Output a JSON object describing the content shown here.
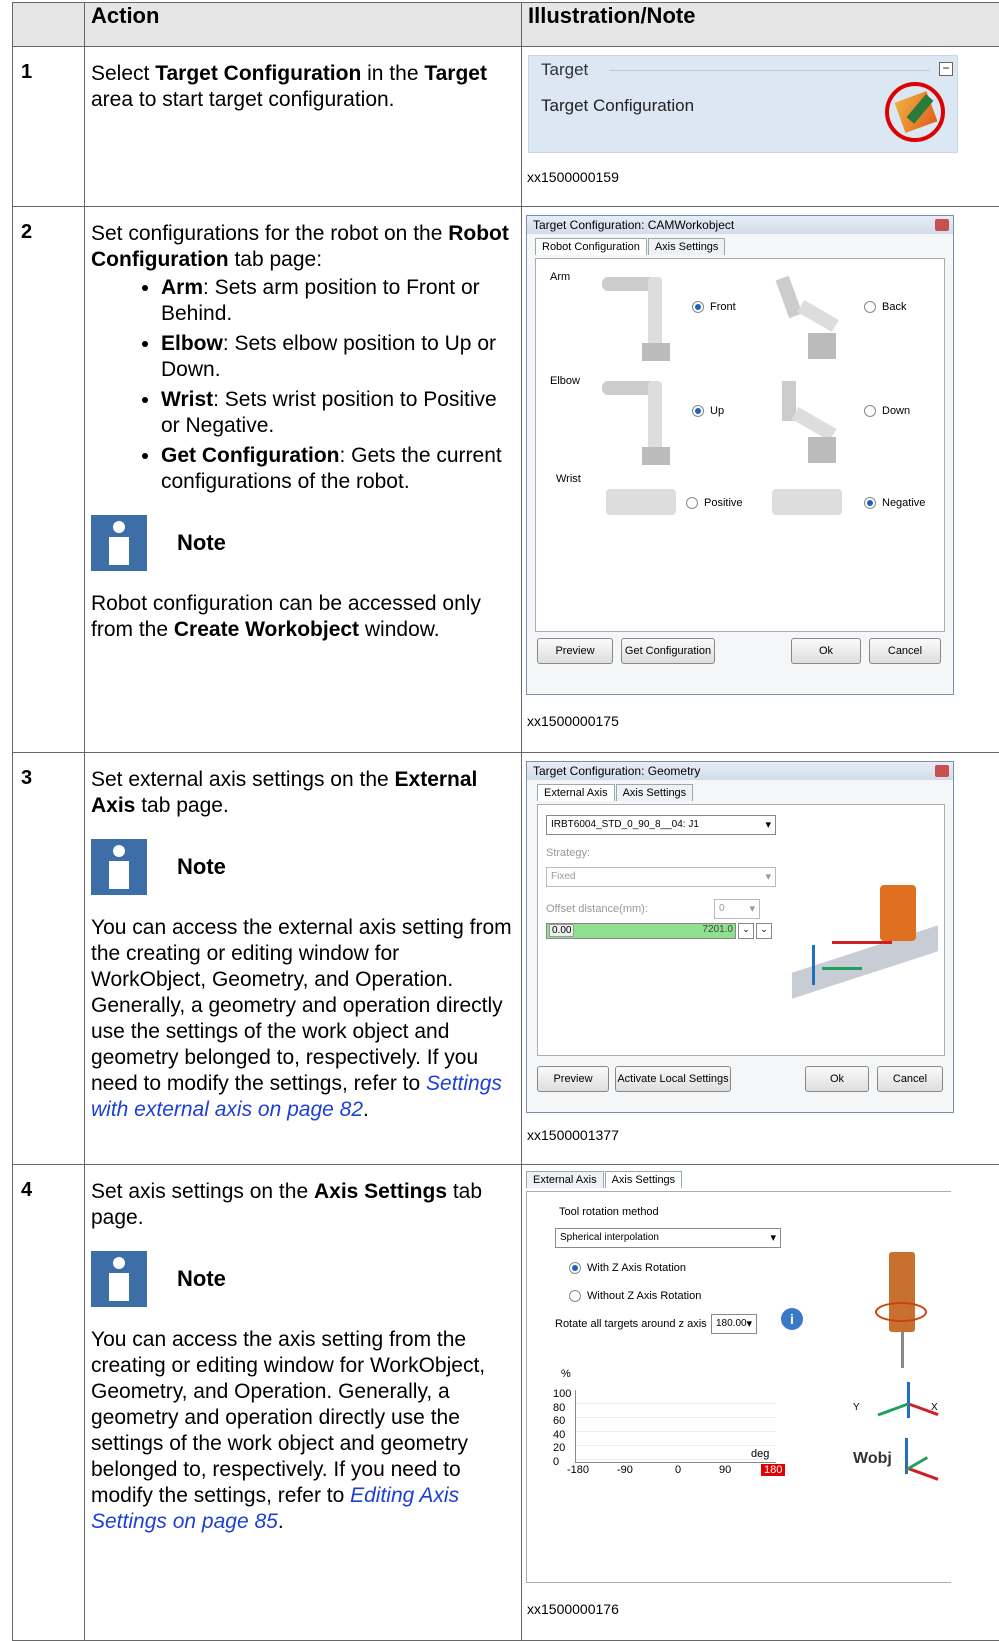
{
  "table": {
    "headers": [
      "",
      "Action",
      "Illustration/Note"
    ]
  },
  "rows": [
    {
      "num": "1",
      "action_parts": [
        "Select ",
        "Target Configuration",
        " in the ",
        "Target",
        " area to start target configuration."
      ],
      "figure": {
        "area_title": "Target",
        "item_label": "Target Configuration",
        "code": "xx1500000159"
      }
    },
    {
      "num": "2",
      "intro_parts": [
        "Set configurations for the robot on the ",
        "Robot Configuration",
        " tab page:"
      ],
      "bullets": [
        {
          "term": "Arm",
          "text": ": Sets arm position to Front or Behind."
        },
        {
          "term": "Elbow",
          "text": ": Sets elbow position to Up or Down."
        },
        {
          "term": "Wrist",
          "text": ": Sets wrist position to Positive or Negative."
        },
        {
          "term": "Get Configuration",
          "text": ": Gets the current configurations of the robot."
        }
      ],
      "note_label": "Note",
      "note_parts": [
        "Robot configuration can be accessed only from the ",
        "Create Workobject",
        " window."
      ],
      "figure": {
        "title": "Target Configuration: CAMWorkobject",
        "tabs": [
          "Robot Configuration",
          "Axis Settings"
        ],
        "groups": [
          {
            "label": "Arm",
            "opt1": "Front",
            "opt2": "Back"
          },
          {
            "label": "Elbow",
            "opt1": "Up",
            "opt2": "Down"
          },
          {
            "label": "Wrist",
            "opt1": "Positive",
            "opt2": "Negative"
          }
        ],
        "buttons": [
          "Preview",
          "Get Configuration",
          "Ok",
          "Cancel"
        ],
        "code": "xx1500000175"
      }
    },
    {
      "num": "3",
      "action_parts": [
        "Set external axis settings on the ",
        "External Axis",
        " tab page."
      ],
      "note_label": "Note",
      "note_text": "You can access the external axis setting from the creating or editing window for WorkObject, Geometry, and Operation. Generally, a geometry and operation directly use the settings of the work object and geometry belonged to, respectively. If you need to modify the settings, refer to ",
      "link": "Settings with external axis on page 82",
      "note_end": ".",
      "figure": {
        "title": "Target Configuration: Geometry",
        "tabs": [
          "External Axis",
          "Axis Settings"
        ],
        "axis_select": "IRBT6004_STD_0_90_8__04: J1",
        "strategy_label": "Strategy:",
        "strategy_value": "Fixed",
        "offset_label": "Offset distance(mm):",
        "offset_value": "0",
        "slider_min": "0.00",
        "slider_max": "7201.0",
        "buttons": [
          "Preview",
          "Activate Local Settings",
          "Ok",
          "Cancel"
        ],
        "code": "xx1500001377"
      }
    },
    {
      "num": "4",
      "action_parts": [
        "Set axis settings on the ",
        "Axis Settings",
        " tab page."
      ],
      "note_label": "Note",
      "note_text": "You can access the axis setting from the creating or editing window for WorkObject, Geometry, and Operation. Generally, a geometry and operation directly use the settings of the work object and geometry belonged to, respectively. If you need to modify the settings, refer to ",
      "link": "Editing Axis Settings on page 85",
      "note_end": ".",
      "figure": {
        "tabs": [
          "External Axis",
          "Axis Settings"
        ],
        "method_label": "Tool rotation method",
        "method_value": "Spherical interpolation",
        "radio1": "With Z Axis Rotation",
        "radio2": "Without Z Axis Rotation",
        "rotate_label": "Rotate all targets around z axis",
        "rotate_value": "180.00",
        "chart_unit": "%",
        "y_ticks": [
          "100",
          "80",
          "60",
          "40",
          "20",
          "0"
        ],
        "x_ticks": [
          "-180",
          "-90",
          "0",
          "90",
          "180"
        ],
        "x_unit": "deg",
        "wobj": "Wobj",
        "code": "xx1500000176"
      }
    }
  ]
}
